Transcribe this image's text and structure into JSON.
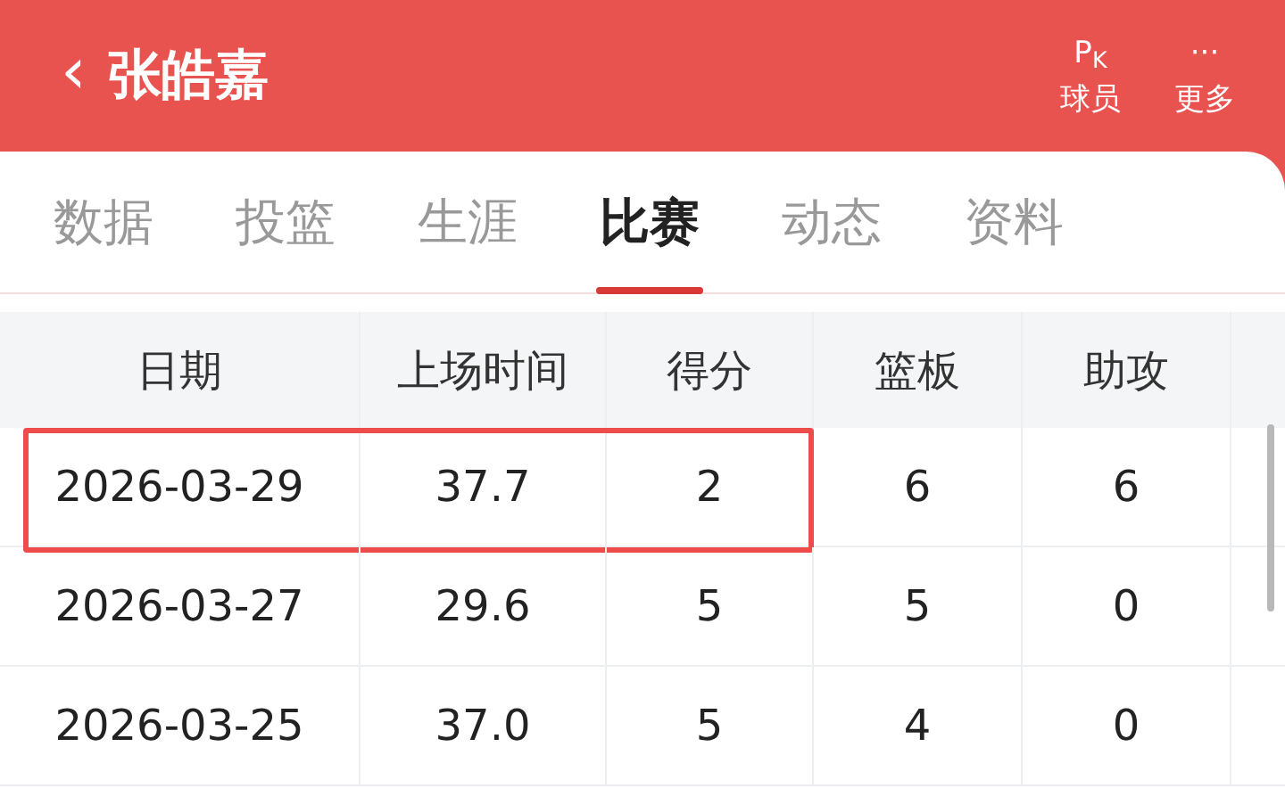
{
  "header": {
    "back_icon": "‹",
    "title": "张皓嘉",
    "actions": [
      {
        "icon": "P$_{K}$",
        "label": "球员"
      },
      {
        "icon": "···",
        "label": "更多"
      }
    ]
  },
  "tabs": [
    {
      "label": "数据",
      "selected": false
    },
    {
      "label": "投篮",
      "selected": false
    },
    {
      "label": "生涯",
      "selected": false
    },
    {
      "label": "比赛",
      "selected": true
    },
    {
      "label": "动态",
      "selected": false
    },
    {
      "label": "资料",
      "selected": false
    }
  ],
  "table": {
    "columns": [
      "日期",
      "上场时间",
      "得分",
      "篮板",
      "助攻"
    ],
    "rows": [
      {
        "cells": [
          "2026-03-29",
          "37.7",
          "2",
          "6",
          "6"
        ],
        "highlighted": true
      },
      {
        "cells": [
          "2026-03-27",
          "29.6",
          "5",
          "5",
          "0"
        ],
        "highlighted": false
      },
      {
        "cells": [
          "2026-03-25",
          "37.0",
          "5",
          "4",
          "0"
        ],
        "highlighted": false
      }
    ]
  }
}
